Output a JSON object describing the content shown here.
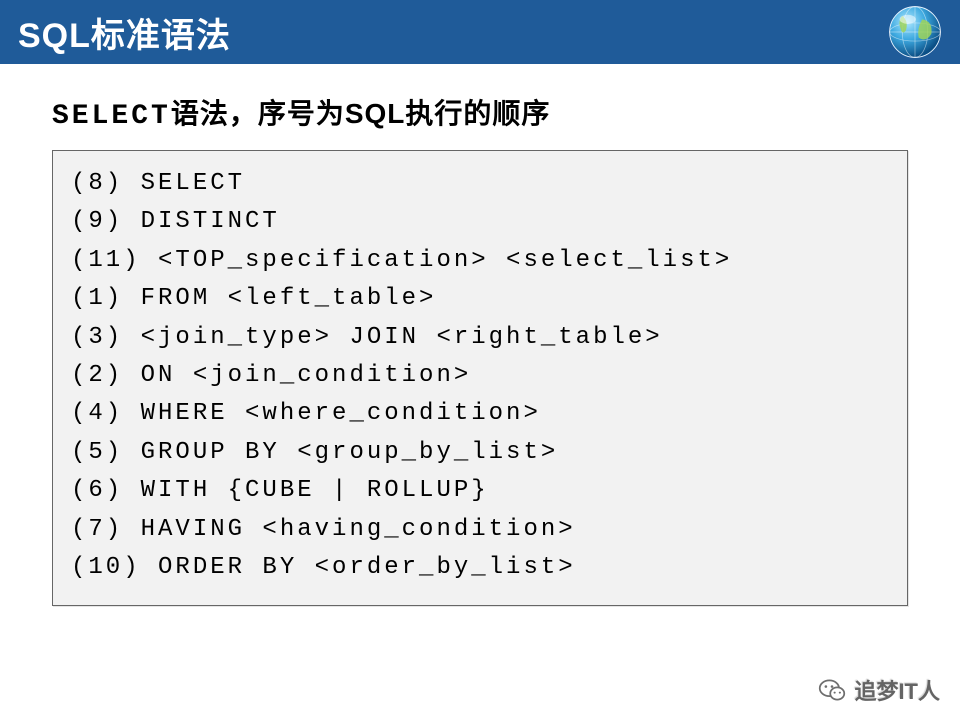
{
  "header": {
    "title": "SQL标准语法"
  },
  "subheading": {
    "mono": "SELECT",
    "rest": "语法，序号为SQL执行的顺序"
  },
  "code_lines": [
    "(8) SELECT",
    "(9) DISTINCT",
    "(11) <TOP_specification> <select_list>",
    "(1) FROM <left_table>",
    "(3) <join_type> JOIN <right_table>",
    "(2) ON <join_condition>",
    "(4) WHERE <where_condition>",
    "(5) GROUP BY <group_by_list>",
    "(6) WITH {CUBE | ROLLUP}",
    "(7) HAVING <having_condition>",
    "(10) ORDER BY <order_by_list>"
  ],
  "footer": {
    "brand": "追梦IT人"
  }
}
